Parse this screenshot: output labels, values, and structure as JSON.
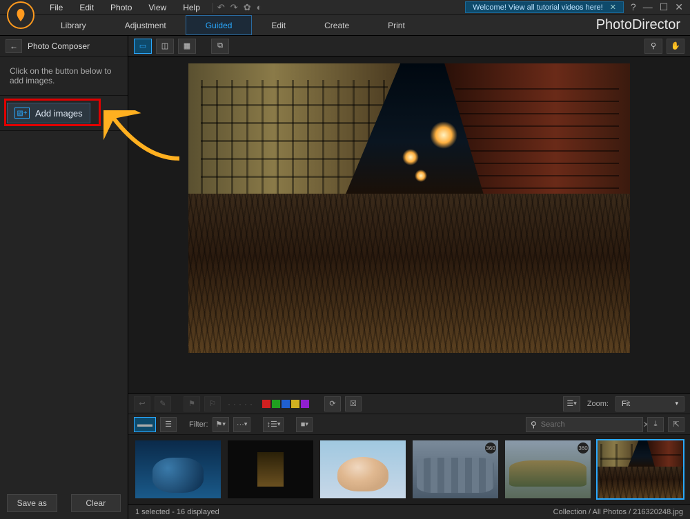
{
  "menubar": {
    "items": [
      "File",
      "Edit",
      "Photo",
      "View",
      "Help"
    ],
    "tutorial_banner": "Welcome! View all tutorial videos here!"
  },
  "brand": "PhotoDirector",
  "mode_tabs": {
    "items": [
      "Library",
      "Adjustment",
      "Guided",
      "Edit",
      "Create",
      "Print"
    ],
    "active_index": 2
  },
  "left_panel": {
    "title": "Photo Composer",
    "instruction": "Click on the button below to add images.",
    "add_images_label": "Add images",
    "save_as_label": "Save as",
    "clear_label": "Clear"
  },
  "lower_toolbar": {
    "zoom_label": "Zoom:",
    "zoom_value": "Fit",
    "filter_label": "Filter:",
    "search_placeholder": "Search",
    "color_swatches": [
      "#d02020",
      "#20a020",
      "#2060d0",
      "#d0b020",
      "#9020d0"
    ]
  },
  "statusbar": {
    "left": "1 selected - 16 displayed",
    "right": "Collection / All Photos / 216320248.jpg"
  }
}
